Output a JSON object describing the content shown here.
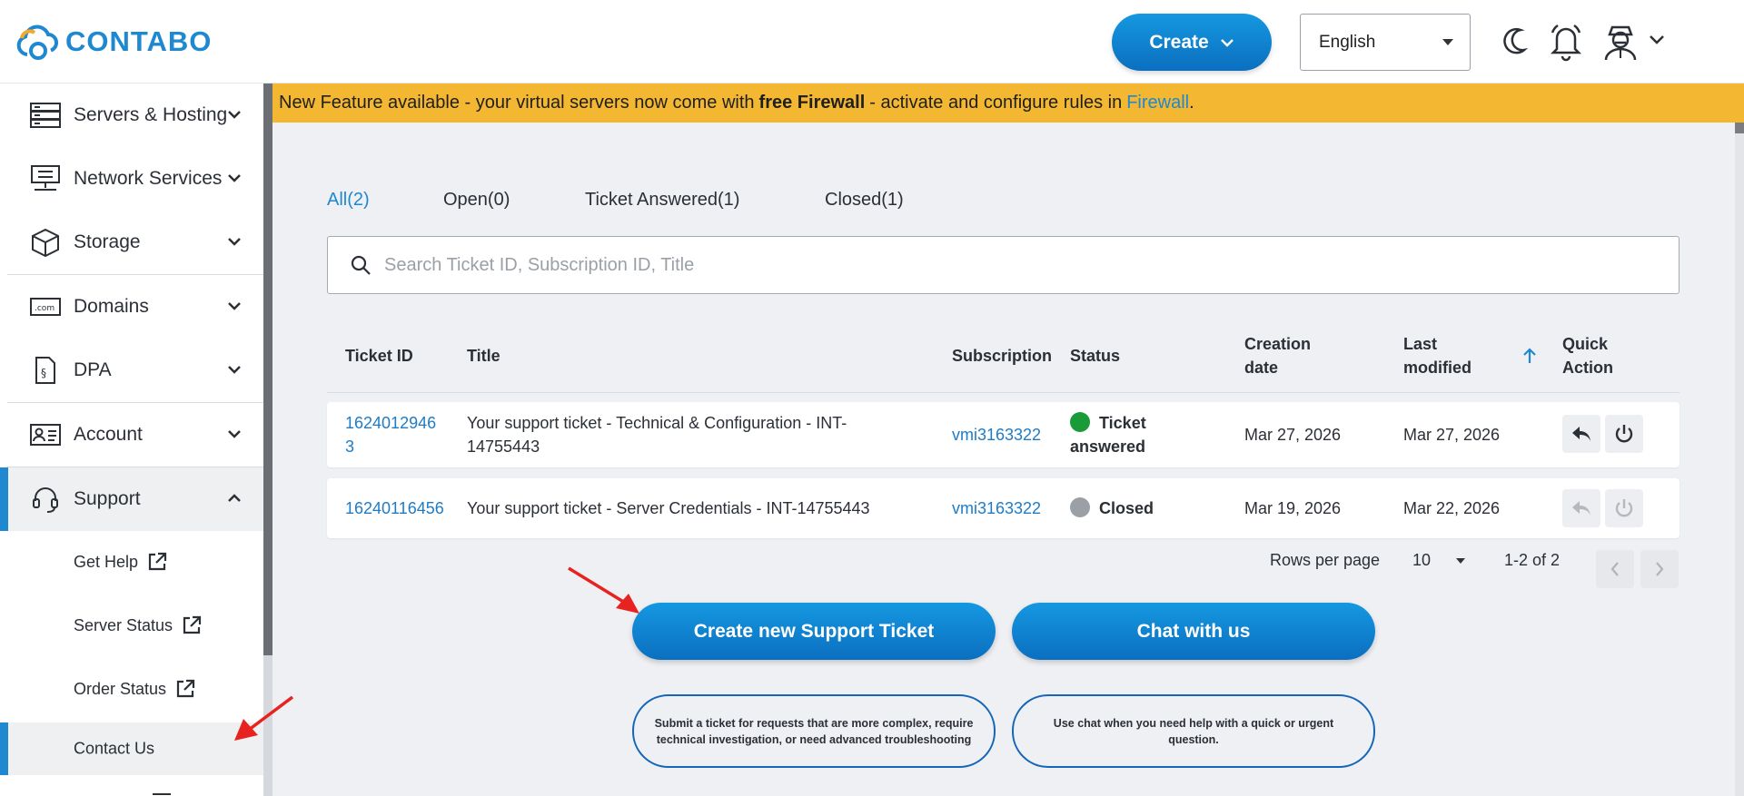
{
  "brand": {
    "name": "CONTABO",
    "color": "#1e88d0"
  },
  "header": {
    "create_label": "Create",
    "language": "English",
    "icons": [
      "moon-icon",
      "bell-icon",
      "user-avatar-icon",
      "chevron-down-icon"
    ]
  },
  "sidebar": {
    "items": [
      {
        "label": "Servers & Hosting",
        "icon": "servers-icon"
      },
      {
        "label": "Network Services",
        "icon": "network-icon"
      },
      {
        "label": "Storage",
        "icon": "box-icon"
      },
      {
        "label": "Domains",
        "icon": "domain-icon"
      },
      {
        "label": "DPA",
        "icon": "document-icon"
      },
      {
        "label": "Account",
        "icon": "id-card-icon"
      },
      {
        "label": "Support",
        "icon": "headset-icon",
        "expanded": true
      }
    ],
    "support_sub": [
      {
        "label": "Get Help",
        "external": true
      },
      {
        "label": "Server Status",
        "external": true
      },
      {
        "label": "Order Status",
        "external": true
      },
      {
        "label": "Contact Us",
        "external": false
      }
    ]
  },
  "banner": {
    "text_start": "New Feature available - your virtual servers now come with",
    "bold": "free Firewall",
    "text_mid": "- activate and configure rules in",
    "link": "Firewall",
    "text_end": "."
  },
  "tabs": [
    {
      "label": "All(2)",
      "active": true
    },
    {
      "label": "Open(0)",
      "active": false
    },
    {
      "label": "Ticket Answered(1)",
      "active": false
    },
    {
      "label": "Closed(1)",
      "active": false
    }
  ],
  "search": {
    "placeholder": "Search Ticket ID, Subscription ID, Title"
  },
  "table": {
    "headers": {
      "ticket_id": "Ticket ID",
      "title": "Title",
      "subscription": "Subscription",
      "status": "Status",
      "creation_1": "Creation",
      "creation_2": "date",
      "modified_1": "Last",
      "modified_2": "modified",
      "quick_1": "Quick",
      "quick_2": "Action"
    },
    "rows": [
      {
        "ticket_id_1": "1624012946",
        "ticket_id_2": "3",
        "title_1": "Your support ticket - Technical & Configuration - INT-",
        "title_2": "14755443",
        "subscription": "vmi3163322",
        "status_1": "Ticket",
        "status_2": "answered",
        "status_color": "#1a9b3a",
        "created": "Mar 27, 2026",
        "modified": "Mar 27, 2026"
      },
      {
        "ticket_id_1": "16240116456",
        "title_1": "Your support ticket - Server Credentials - INT-14755443",
        "subscription": "vmi3163322",
        "status_1": "Closed",
        "status_color": "#9aa0a6",
        "created": "Mar 19, 2026",
        "modified": "Mar 22, 2026"
      }
    ]
  },
  "pagination": {
    "rows_label": "Rows per page",
    "rows_value": "10",
    "range": "1-2 of 2"
  },
  "actions": {
    "create_ticket": "Create new Support Ticket",
    "chat": "Chat with us",
    "create_hint": "Submit a ticket for requests that are more complex, require technical investigation, or need advanced troubleshooting",
    "chat_hint": "Use chat when you need help with a quick or urgent question."
  },
  "annotation_color": "#e8231f"
}
